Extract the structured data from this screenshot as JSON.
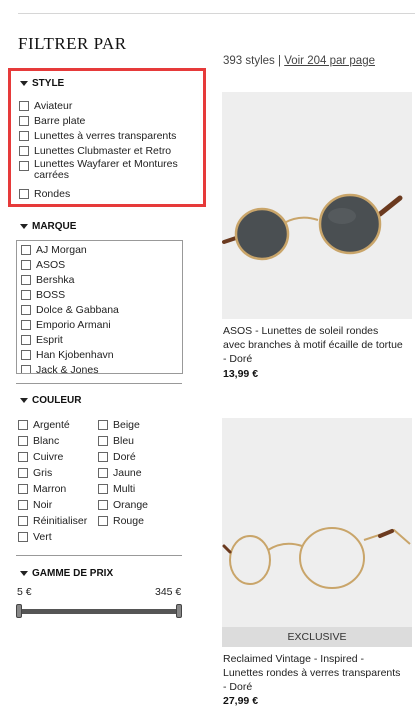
{
  "filter_title": "FILTRER PAR",
  "style": {
    "heading": "STYLE",
    "options": [
      "Aviateur",
      "Barre plate",
      "Lunettes à verres transparents",
      "Lunettes Clubmaster et Retro",
      "Lunettes Wayfarer et Montures carrées",
      "Rondes"
    ]
  },
  "marque": {
    "heading": "MARQUE",
    "options": [
      "AJ Morgan",
      "ASOS",
      "Bershka",
      "BOSS",
      "Dolce & Gabbana",
      "Emporio Armani",
      "Esprit",
      "Han Kjobenhavn",
      "Jack & Jones"
    ]
  },
  "couleur": {
    "heading": "COULEUR",
    "col1": [
      "Argenté",
      "Blanc",
      "Cuivre",
      "Gris",
      "Marron",
      "Noir",
      "Réinitialiser",
      "Vert"
    ],
    "col2": [
      "Beige",
      "Bleu",
      "Doré",
      "Jaune",
      "Multi",
      "Orange",
      "Rouge"
    ]
  },
  "prix": {
    "heading": "GAMME DE PRIX",
    "min": "5 €",
    "max": "345 €"
  },
  "results": {
    "count": "393 styles",
    "separator": "|",
    "per_page": "Voir 204 par page"
  },
  "products": [
    {
      "name": "ASOS - Lunettes de soleil rondes avec branches à motif écaille de tortue - Doré",
      "price": "13,99 €"
    },
    {
      "name": "Reclaimed Vintage - Inspired - Lunettes rondes à verres transparents - Doré",
      "price": "27,99 €",
      "badge": "EXCLUSIVE"
    }
  ],
  "colors": {
    "highlight": "#e63a3a",
    "frame_gold": "#c9a56a",
    "tortoise": "#6b3a1f"
  }
}
